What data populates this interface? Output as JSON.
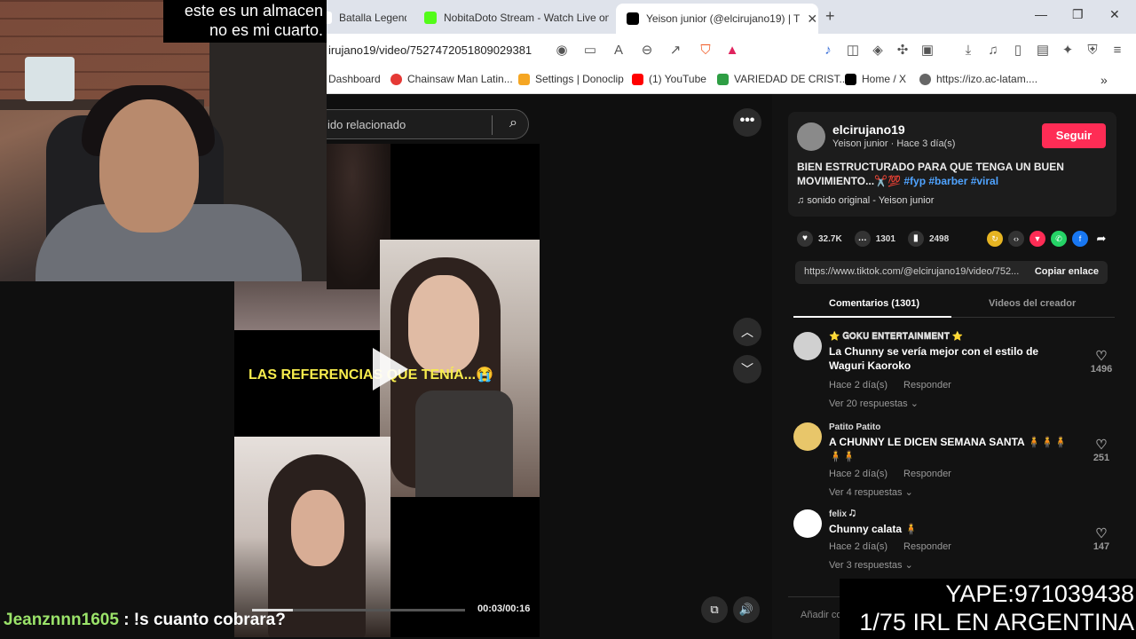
{
  "browser": {
    "tabs": [
      {
        "label": "Batalla Legendar",
        "color": "#ffffff"
      },
      {
        "label": "NobitaDoto Stream - Watch Live on",
        "color": "#53fc18"
      },
      {
        "label": "Yeison junior (@elcirujano19) | T",
        "color": "#000000"
      }
    ],
    "url": "irujano19/video/7527472051809029381",
    "bookmarks": [
      {
        "label": "Dashboard",
        "color": "#ffffff"
      },
      {
        "label": "Chainsaw Man Latin...",
        "color": "#e53935"
      },
      {
        "label": "Settings | Donoclip",
        "color": "#f5a623"
      },
      {
        "label": "(1) YouTube",
        "color": "#ff0000"
      },
      {
        "label": "VARIEDAD DE CRIST...",
        "color": "#2e9e44"
      },
      {
        "label": "Home / X",
        "color": "#000000"
      },
      {
        "label": "https://izo.ac-latam....",
        "color": "#666666"
      }
    ]
  },
  "video": {
    "search_placeholder": "ido relacionado",
    "caption": "LAS REFERENCIAS QUE TENÍA...😭",
    "time": "00:03/00:16",
    "progress": 0.19
  },
  "post": {
    "username": "elcirujano19",
    "subtitle": "Yeison junior · Hace 3 día(s)",
    "follow_label": "Seguir",
    "description": "BIEN ESTRUCTURADO PARA QUE TENGA UN BUEN MOVIMIENTO...✂️💯",
    "tags": "#fyp #barber #viral",
    "sound": "sonido original - Yeison junior",
    "likes": "32.7K",
    "comments": "1301",
    "saves": "2498",
    "link": "https://www.tiktok.com/@elcirujano19/video/752...",
    "copy_label": "Copiar enlace",
    "tab_comments": "Comentarios (1301)",
    "tab_creator": "Videos del creador",
    "add_comment": "Añadir co"
  },
  "comments": [
    {
      "name": "⭐ 𝐆𝐎𝐊𝐔 𝐄𝐍𝐓𝐄𝐑𝐓𝐀𝐈𝐍𝐌𝐄𝐍𝐓 ⭐",
      "text": "La Chunny se vería mejor con el estilo de Waguri Kaoroko",
      "time": "Hace 2 día(s)",
      "reply": "Responder",
      "more": "Ver 20 respuestas ⌄",
      "likes": "1496",
      "avatar_color": "#d0d0d0"
    },
    {
      "name": "Patito Patito",
      "text": "A CHUNNY LE DICEN SEMANA SANTA 🧍🧍🧍🧍🧍",
      "time": "Hace 2 día(s)",
      "reply": "Responder",
      "more": "Ver 4 respuestas ⌄",
      "likes": "251",
      "avatar_color": "#e8c66a"
    },
    {
      "name": "felix 🎝",
      "text": "Chunny calata 🧍",
      "time": "Hace 2 día(s)",
      "reply": "Responder",
      "more": "Ver 3 respuestas ⌄",
      "likes": "147",
      "avatar_color": "#ffffff"
    }
  ],
  "overlay": {
    "subtitle_line1": "este es un almacen",
    "subtitle_line2": "no es mi cuarto.",
    "chat_user": "Jeanznnn1605",
    "chat_msg": ": !s cuanto cobrara?",
    "yape": "YAPE:971039438",
    "irl": "1/75 IRL EN ARGENTINA"
  }
}
